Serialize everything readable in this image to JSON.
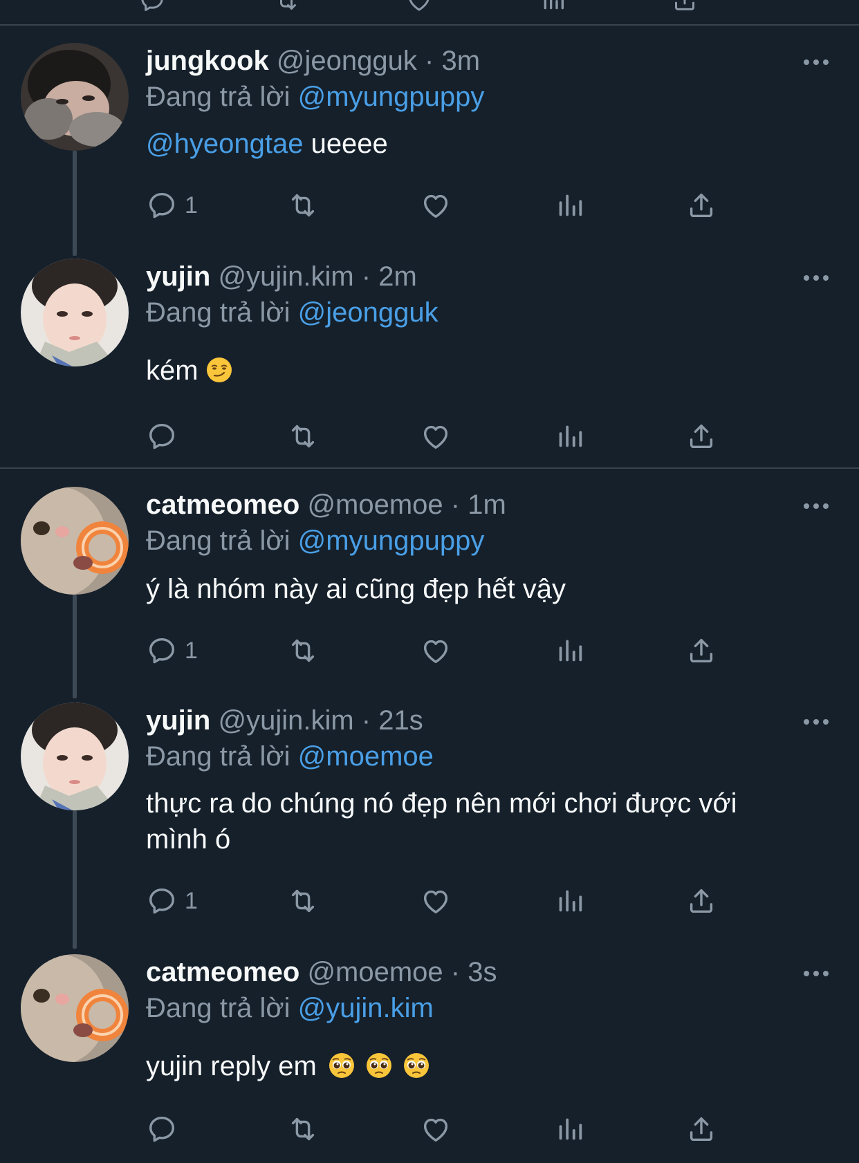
{
  "colors": {
    "background": "#15202b",
    "text": "#f7f9f9",
    "muted": "#8b98a5",
    "mention": "#4a9fe6",
    "divider": "#38444d"
  },
  "replying_prefix": "Đang trả lời",
  "tweets": [
    {
      "name": "jungkook",
      "handle": "@jeongguk",
      "sep": "·",
      "time": "3m",
      "reply_to": "@myungpuppy",
      "mention": "@hyeongtae",
      "text": " ueeee",
      "reply_count": "1",
      "avatar": "avatar-jungkook"
    },
    {
      "name": "yujin",
      "handle": "@yujin.kim",
      "sep": "·",
      "time": "2m",
      "reply_to": "@jeongguk",
      "text": "kém",
      "emoji": "smirking-face-emoji",
      "reply_count": "",
      "avatar": "avatar-yujin"
    },
    {
      "name": "catmeomeo",
      "handle": "@moemoe",
      "sep": "·",
      "time": "1m",
      "reply_to": "@myungpuppy",
      "text": "ý là nhóm này ai cũng đẹp hết vậy",
      "reply_count": "1",
      "avatar": "avatar-catmeomeo"
    },
    {
      "name": "yujin",
      "handle": "@yujin.kim",
      "sep": "·",
      "time": "21s",
      "reply_to": "@moemoe",
      "text_line1": "thực ra do chúng nó đẹp nên mới chơi được với",
      "text_line2": "mình ó",
      "reply_count": "1",
      "avatar": "avatar-yujin"
    },
    {
      "name": "catmeomeo",
      "handle": "@moemoe",
      "sep": "·",
      "time": "3s",
      "reply_to": "@yujin.kim",
      "text": "yujin reply em",
      "emoji": "pleading-face-emoji",
      "reply_count": "",
      "avatar": "avatar-catmeomeo"
    }
  ]
}
